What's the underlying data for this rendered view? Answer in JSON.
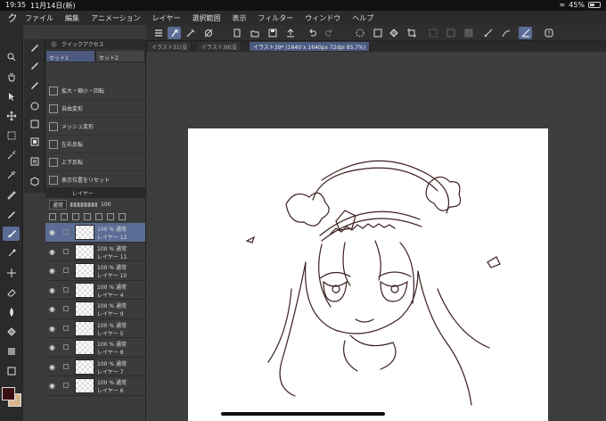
{
  "status": {
    "time": "19:35",
    "date": "11月14日(新)",
    "battery": "45%",
    "battery_level": 0.45
  },
  "menu": {
    "logo": "ク",
    "items": [
      "ファイル",
      "編集",
      "アニメーション",
      "レイヤー",
      "選択範囲",
      "表示",
      "フィルター",
      "ウィンドウ",
      "ヘルプ"
    ]
  },
  "tabs": [
    "イラスト31(没",
    "イラスト38(没",
    "イラスト39* (1640 x 1640px 72dpi 85.7%)"
  ],
  "quick_access": {
    "title": "クイックアクセス",
    "sets": [
      "セット1",
      "セット2"
    ],
    "items": [
      "拡大・縮小・回転",
      "自由変形",
      "メッシュ変形",
      "左右反転",
      "上下反転",
      "表示位置をリセット"
    ]
  },
  "layers": {
    "title": "レイヤー",
    "blend_mode": "通常",
    "opacity": "100",
    "rows": [
      {
        "mode": "100 % 通常",
        "name": "レイヤー 12",
        "selected": true
      },
      {
        "mode": "100 % 通常",
        "name": "レイヤー 11",
        "selected": false
      },
      {
        "mode": "100 % 通常",
        "name": "レイヤー 10",
        "selected": false
      },
      {
        "mode": "100 % 通常",
        "name": "レイヤー 4",
        "selected": false
      },
      {
        "mode": "100 % 通常",
        "name": "レイヤー 9",
        "selected": false
      },
      {
        "mode": "100 % 通常",
        "name": "レイヤー 5",
        "selected": false
      },
      {
        "mode": "100 % 通常",
        "name": "レイヤー 8",
        "selected": false
      },
      {
        "mode": "100 % 通常",
        "name": "レイヤー 7",
        "selected": false
      },
      {
        "mode": "100 % 通常",
        "name": "レイヤー 6",
        "selected": false
      }
    ]
  },
  "colors": {
    "foreground": "#3a0f12",
    "background": "#d9b48f",
    "accent": "#5b6c95"
  }
}
